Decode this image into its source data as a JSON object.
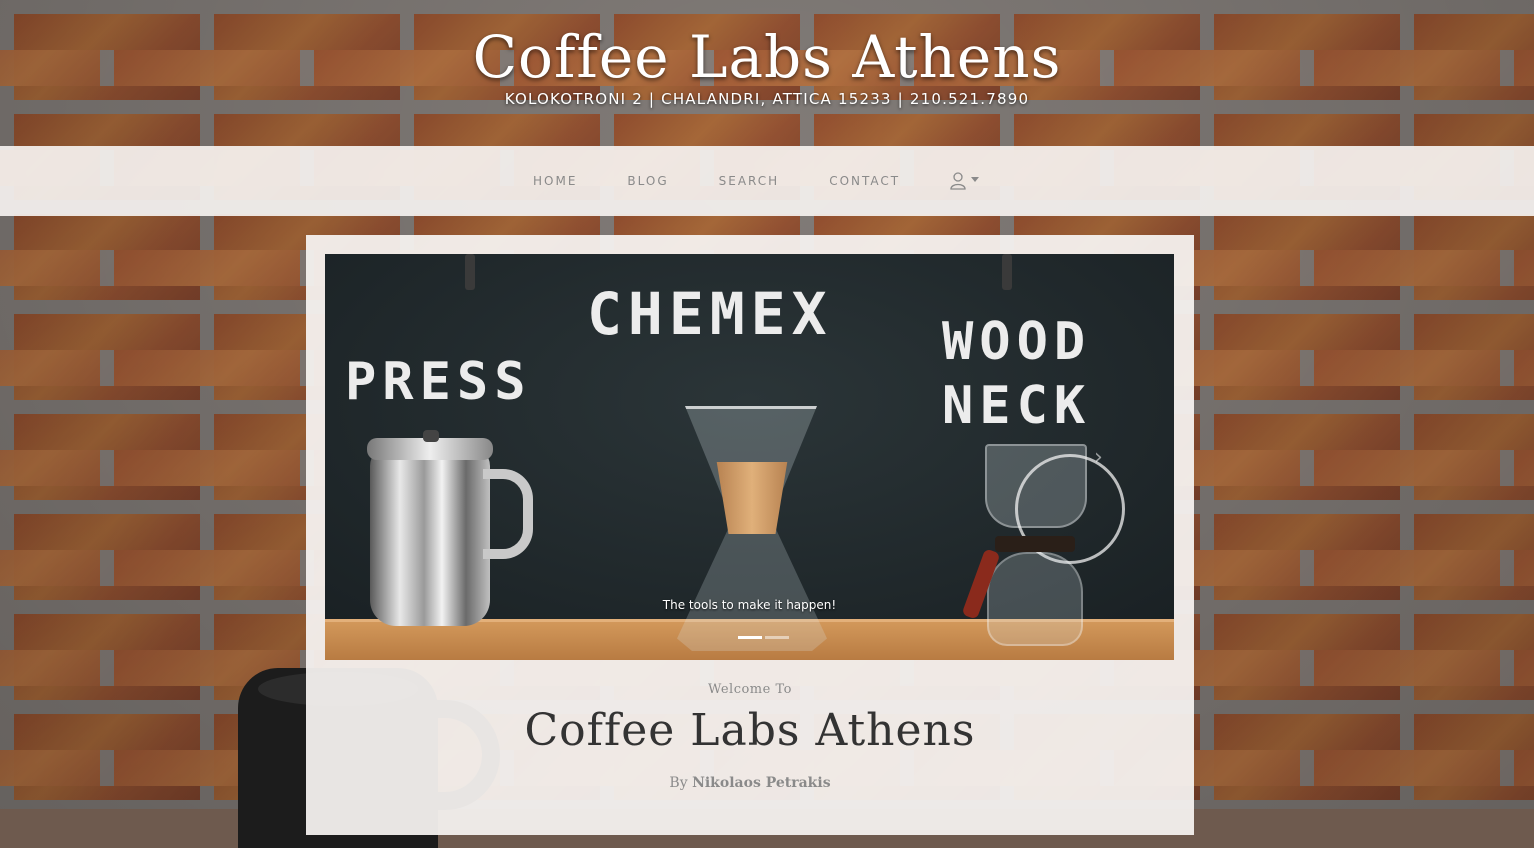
{
  "header": {
    "title": "Coffee Labs Athens",
    "subtitle": "KOLOKOTRONI 2 | CHALANDRI, ATTICA 15233 | 210.521.7890"
  },
  "nav": {
    "items": [
      {
        "label": "HOME"
      },
      {
        "label": "BLOG"
      },
      {
        "label": "SEARCH"
      },
      {
        "label": "CONTACT"
      }
    ],
    "user_icon": "user-icon"
  },
  "carousel": {
    "board_words": [
      "CHEMEX",
      "PRESS",
      "WOOD",
      "NECK"
    ],
    "caption": "The tools to make it happen!",
    "next_icon": "chevron-right-icon",
    "slides_count": 2,
    "active_slide": 1
  },
  "main": {
    "welcome_small": "Welcome To",
    "welcome_title": "Coffee Labs Athens",
    "byline_prefix": "By",
    "byline_author": "Nikolaos Petrakis"
  },
  "colors": {
    "nav_background": "#f5f2f0",
    "nav_text": "#8a8a8a",
    "title_text": "#ffffff",
    "heading_text": "#333333"
  }
}
